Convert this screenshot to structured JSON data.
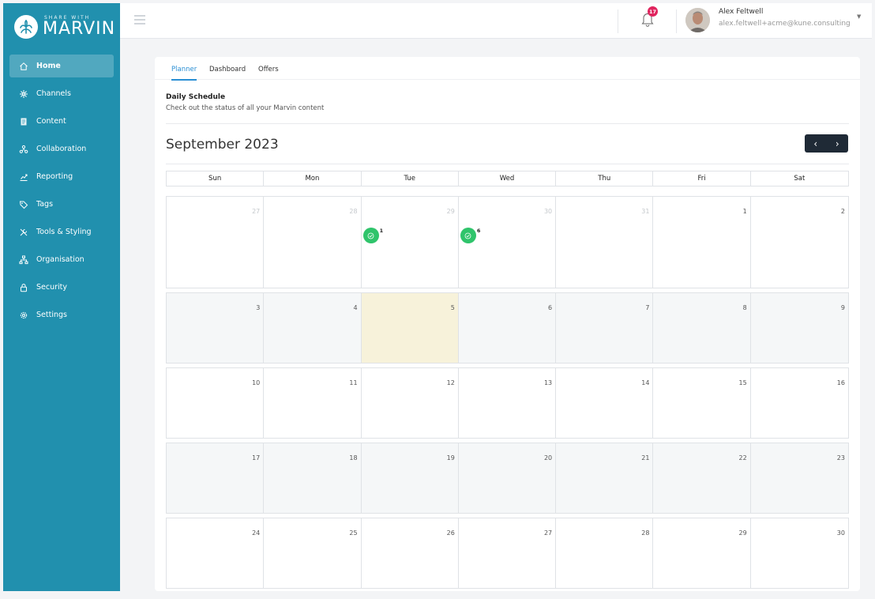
{
  "brand": {
    "tagline": "SHARE WITH",
    "name": "MARVIN"
  },
  "sidebar": {
    "items": [
      {
        "label": "Home",
        "icon": "home-icon",
        "active": true
      },
      {
        "label": "Channels",
        "icon": "channels-icon"
      },
      {
        "label": "Content",
        "icon": "content-icon"
      },
      {
        "label": "Collaboration",
        "icon": "collaboration-icon"
      },
      {
        "label": "Reporting",
        "icon": "reporting-icon"
      },
      {
        "label": "Tags",
        "icon": "tag-icon"
      },
      {
        "label": "Tools & Styling",
        "icon": "tools-icon"
      },
      {
        "label": "Organisation",
        "icon": "organisation-icon"
      },
      {
        "label": "Security",
        "icon": "lock-icon"
      },
      {
        "label": "Settings",
        "icon": "gear-icon"
      }
    ]
  },
  "topbar": {
    "notifications": "17",
    "user_name": "Alex Feltwell",
    "user_email": "alex.feltwell+acme@kune.consulting"
  },
  "tabs": [
    {
      "label": "Planner",
      "active": true
    },
    {
      "label": "Dashboard"
    },
    {
      "label": "Offers"
    }
  ],
  "schedule": {
    "title": "Daily Schedule",
    "subtitle": "Check out the status of all your Marvin content"
  },
  "calendar": {
    "month": "September 2023",
    "prev_label": "‹",
    "next_label": "›",
    "weekdays": [
      "Sun",
      "Mon",
      "Tue",
      "Wed",
      "Thu",
      "Fri",
      "Sat"
    ],
    "weeks": [
      [
        "27",
        "28",
        "29",
        "30",
        "31",
        "1",
        "2"
      ],
      [
        "3",
        "4",
        "5",
        "6",
        "7",
        "8",
        "9"
      ],
      [
        "10",
        "11",
        "12",
        "13",
        "14",
        "15",
        "16"
      ],
      [
        "17",
        "18",
        "19",
        "20",
        "21",
        "22",
        "23"
      ],
      [
        "24",
        "25",
        "26",
        "27",
        "28",
        "29",
        "30"
      ]
    ],
    "events": [
      {
        "week": 0,
        "day": 2,
        "count": "1"
      },
      {
        "week": 0,
        "day": 3,
        "count": "6"
      }
    ],
    "colors": {
      "event": "#2fc46b",
      "today": "#f7f2da",
      "accent": "#2a8fd4",
      "sidebar": "#2190ae"
    }
  }
}
